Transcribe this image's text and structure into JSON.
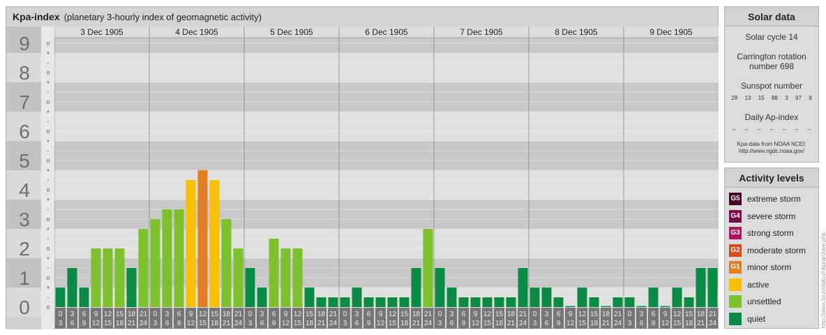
{
  "header": {
    "title": "Kpa-index",
    "subtitle": "(planetary 3-hourly index of geomagnetic activity)"
  },
  "chart_data": {
    "type": "bar",
    "y_ticks": [
      "0",
      "1",
      "2",
      "3",
      "4",
      "5",
      "6",
      "7",
      "8",
      "9"
    ],
    "y_subticks": [
      "o",
      "-",
      "+"
    ],
    "ylim": [
      0,
      9.33
    ],
    "days": [
      "3 Dec 1905",
      "4 Dec 1905",
      "5 Dec 1905",
      "6 Dec 1905",
      "7 Dec 1905",
      "8 Dec 1905",
      "9 Dec 1905"
    ],
    "slot_top": [
      "0",
      "3",
      "6",
      "9",
      "12",
      "15",
      "18",
      "21"
    ],
    "slot_bottom": [
      "3",
      "6",
      "9",
      "12",
      "15",
      "18",
      "21",
      "24"
    ],
    "values": [
      [
        0.667,
        1.333,
        0.667,
        2,
        2,
        2,
        1.333,
        2.667
      ],
      [
        3,
        3.333,
        3.333,
        4.333,
        4.667,
        4.333,
        3,
        2
      ],
      [
        1.333,
        0.667,
        2.333,
        2,
        2,
        0.667,
        0.333,
        0.333
      ],
      [
        0.333,
        0.667,
        0.333,
        0.333,
        0.333,
        0.333,
        1.333,
        2.667
      ],
      [
        1.333,
        0.667,
        0.333,
        0.333,
        0.333,
        0.333,
        0.333,
        1.333
      ],
      [
        0.667,
        0.667,
        0.333,
        0,
        0.667,
        0.333,
        0,
        0.333
      ],
      [
        0.333,
        0,
        0.667,
        0,
        0.667,
        0.333,
        1.333,
        1.333
      ]
    ]
  },
  "solar": {
    "heading": "Solar data",
    "cycle": "Solar cycle 14",
    "carrington": "Carrington rotation number 698",
    "sunspot_label": "Sunspot number",
    "sunspots": [
      "28",
      "13",
      "15",
      "88",
      "3",
      "97",
      "8"
    ],
    "ap_label": "Daily Ap-index",
    "ap": [
      "--",
      "--",
      "--",
      "--",
      "--",
      "--",
      "--"
    ],
    "source_1": "Kpa-data from NOAA NCEI:",
    "source_2": "http://www.ngdc.noaa.gov/"
  },
  "levels": {
    "heading": "Activity levels",
    "items": [
      {
        "badge": "G5",
        "label": "extreme storm",
        "color": "#4a0026"
      },
      {
        "badge": "G4",
        "label": "severe storm",
        "color": "#7a0c4a"
      },
      {
        "badge": "G3",
        "label": "strong storm",
        "color": "#b3125f"
      },
      {
        "badge": "G2",
        "label": "moderate storm",
        "color": "#d9491c"
      },
      {
        "badge": "G1",
        "label": "minor storm",
        "color": "#e37e23"
      },
      {
        "badge": "",
        "label": "active",
        "color": "#f7c000"
      },
      {
        "badge": "",
        "label": "unsettled",
        "color": "#7dc12c"
      },
      {
        "badge": "",
        "label": "quiet",
        "color": "#0a8a45"
      }
    ]
  },
  "credit": "http://www.fourmilab.ch/kp/archive.php"
}
